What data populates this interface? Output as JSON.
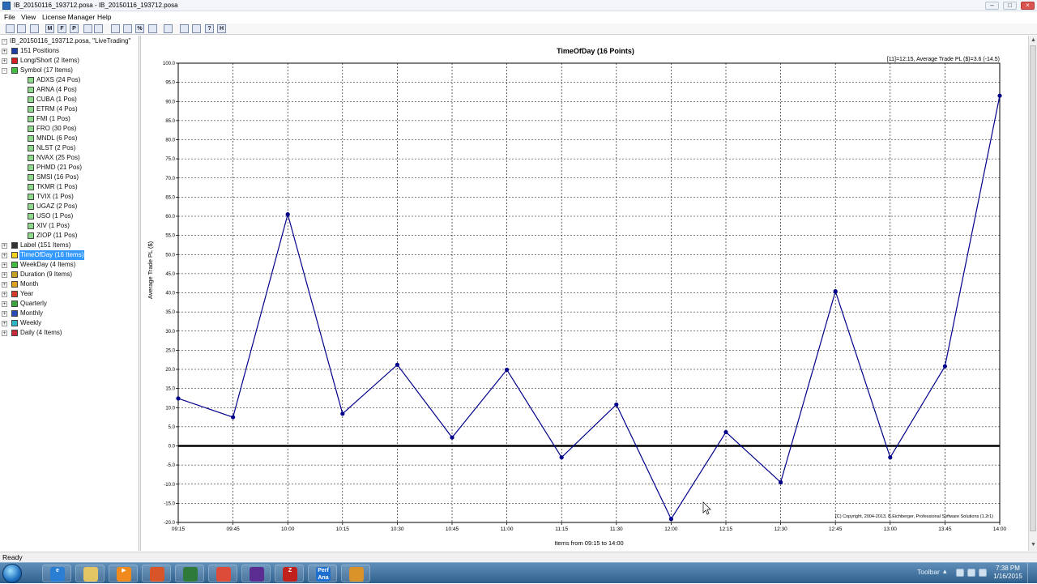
{
  "window": {
    "title": "IB_20150116_193712.posa - IB_20150116_193712.posa"
  },
  "menu": {
    "items": [
      "File",
      "View",
      "License Manager",
      "Help"
    ]
  },
  "toolbar": {
    "buttons": [
      {
        "icon": "new-icon",
        "glyph": ""
      },
      {
        "icon": "open-icon",
        "glyph": ""
      },
      {
        "icon": "print-icon",
        "glyph": ""
      },
      {
        "icon": "module-m-icon",
        "glyph": "M"
      },
      {
        "icon": "module-f-icon",
        "glyph": "F"
      },
      {
        "icon": "module-p-icon",
        "glyph": "P"
      },
      {
        "icon": "filter-icon",
        "glyph": ""
      },
      {
        "icon": "calendar-icon",
        "glyph": ""
      },
      {
        "icon": "chart-up-icon",
        "glyph": ""
      },
      {
        "icon": "chart-line-icon",
        "glyph": ""
      },
      {
        "icon": "percent-icon",
        "glyph": "%"
      },
      {
        "icon": "table-icon",
        "glyph": ""
      },
      {
        "icon": "tools-icon",
        "glyph": ""
      },
      {
        "icon": "report-icon",
        "glyph": ""
      },
      {
        "icon": "layers-icon",
        "glyph": ""
      },
      {
        "icon": "help-icon",
        "glyph": "?"
      },
      {
        "icon": "module-h-icon",
        "glyph": "H"
      }
    ]
  },
  "tree": {
    "root": "IB_20150116_193712.posa, \"LiveTrading\"",
    "items": [
      {
        "label": "151 Positions",
        "level": 1,
        "color": "#1f3fa8",
        "exp": "+"
      },
      {
        "label": "Long/Short (2 Items)",
        "level": 1,
        "color": "#d42020",
        "exp": "+"
      },
      {
        "label": "Symbol (17 Items)",
        "level": 1,
        "color": "#3fbf3f",
        "exp": "-"
      },
      {
        "label": "ADXS (24 Pos)",
        "level": 2,
        "color": "#8fd98f",
        "exp": ""
      },
      {
        "label": "ARNA (4 Pos)",
        "level": 2,
        "color": "#8fd98f",
        "exp": ""
      },
      {
        "label": "CUBA (1 Pos)",
        "level": 2,
        "color": "#8fd98f",
        "exp": ""
      },
      {
        "label": "ETRM (4 Pos)",
        "level": 2,
        "color": "#8fd98f",
        "exp": ""
      },
      {
        "label": "FMI (1 Pos)",
        "level": 2,
        "color": "#8fd98f",
        "exp": ""
      },
      {
        "label": "FRO (30 Pos)",
        "level": 2,
        "color": "#8fd98f",
        "exp": ""
      },
      {
        "label": "MNDL (6 Pos)",
        "level": 2,
        "color": "#8fd98f",
        "exp": ""
      },
      {
        "label": "NLST (2 Pos)",
        "level": 2,
        "color": "#8fd98f",
        "exp": ""
      },
      {
        "label": "NVAX (25 Pos)",
        "level": 2,
        "color": "#8fd98f",
        "exp": ""
      },
      {
        "label": "PHMD (21 Pos)",
        "level": 2,
        "color": "#8fd98f",
        "exp": ""
      },
      {
        "label": "SMSI (16 Pos)",
        "level": 2,
        "color": "#8fd98f",
        "exp": ""
      },
      {
        "label": "TKMR (1 Pos)",
        "level": 2,
        "color": "#8fd98f",
        "exp": ""
      },
      {
        "label": "TVIX (1 Pos)",
        "level": 2,
        "color": "#8fd98f",
        "exp": ""
      },
      {
        "label": "UGAZ (2 Pos)",
        "level": 2,
        "color": "#8fd98f",
        "exp": ""
      },
      {
        "label": "USO (1 Pos)",
        "level": 2,
        "color": "#8fd98f",
        "exp": ""
      },
      {
        "label": "XIV (1 Pos)",
        "level": 2,
        "color": "#8fd98f",
        "exp": ""
      },
      {
        "label": "ZIOP (11 Pos)",
        "level": 2,
        "color": "#8fd98f",
        "exp": ""
      },
      {
        "label": "Label (151 Items)",
        "level": 1,
        "color": "#333333",
        "exp": "+"
      },
      {
        "label": "TimeOfDay (16 Items)",
        "level": 1,
        "color": "#f2d21a",
        "exp": "+",
        "selected": true
      },
      {
        "label": "WeekDay (4 Items)",
        "level": 1,
        "color": "#3fbf3f",
        "exp": "+"
      },
      {
        "label": "Duration (9 Items)",
        "level": 1,
        "color": "#c8a020",
        "exp": "+"
      },
      {
        "label": "Month",
        "level": 1,
        "color": "#e0a020",
        "exp": "+"
      },
      {
        "label": "Year",
        "level": 1,
        "color": "#d83a2a",
        "exp": "+"
      },
      {
        "label": "Quarterly",
        "level": 1,
        "color": "#3aa83a",
        "exp": "+"
      },
      {
        "label": "Monthly",
        "level": 1,
        "color": "#2a4ab8",
        "exp": "+"
      },
      {
        "label": "Weekly",
        "level": 1,
        "color": "#2ab8c8",
        "exp": "+"
      },
      {
        "label": "Daily (4 Items)",
        "level": 1,
        "color": "#c82a3a",
        "exp": "+"
      }
    ]
  },
  "chart_data": {
    "type": "line",
    "title": "TimeOfDay (16 Points)",
    "info": "[11]=12:15,   Average Trade PL ($)=3.6 (-14.5)",
    "ylabel": "Average Trade PL ($)",
    "xlabel": "Items from 09:15 to 14:00",
    "copyright": "(C) Copyright, 2004-2013, B.Eichberger, Professional Software Solutions (1.2r1)",
    "ylim": [
      -20,
      100
    ],
    "ystep": 5,
    "ytick_labels": [
      "-20.0",
      "-15.0",
      "-10.0",
      "-5.0",
      "0.0",
      "5.0",
      "10.0",
      "15.0",
      "20.0",
      "25.0",
      "30.0",
      "35.0",
      "40.0",
      "45.0",
      "50.0",
      "55.0",
      "60.0",
      "65.0",
      "70.0",
      "75.0",
      "80.0",
      "85.0",
      "90.0",
      "95.0",
      "100.0"
    ],
    "categories": [
      "09:15",
      "09:45",
      "10:00",
      "10:15",
      "10:30",
      "10:45",
      "11:00",
      "11:15",
      "11:30",
      "12:00",
      "12:15",
      "12:30",
      "12:45",
      "13:00",
      "13:45",
      "14:00"
    ],
    "values": [
      12.4,
      7.5,
      60.5,
      8.4,
      21.2,
      2.2,
      19.9,
      -3.0,
      10.8,
      -19.1,
      3.6,
      -9.5,
      40.4,
      -3.0,
      20.8,
      91.5
    ],
    "line_color": "#00008b",
    "zero_line": true,
    "grid": true
  },
  "status": {
    "text": "Ready"
  },
  "taskbar": {
    "apps": [
      {
        "icon": "internet-explorer-icon",
        "color": "#2a7fd4",
        "glyph": "e"
      },
      {
        "icon": "file-explorer-icon",
        "color": "#e3c565",
        "glyph": ""
      },
      {
        "icon": "media-player-icon",
        "color": "#f08a1c",
        "glyph": "▶"
      },
      {
        "icon": "paint-icon",
        "color": "#d8552a",
        "glyph": ""
      },
      {
        "icon": "terminal-icon",
        "color": "#2d7a3a",
        "glyph": ""
      },
      {
        "icon": "chrome-icon",
        "color": "#dd4b39",
        "glyph": ""
      },
      {
        "icon": "visual-studio-icon",
        "color": "#5b2d91",
        "glyph": ""
      },
      {
        "icon": "filezilla-icon",
        "color": "#c0211d",
        "glyph": "Z"
      },
      {
        "icon": "perf-ana-icon",
        "color": "#1f6fd1",
        "glyph": "Perf Ana"
      },
      {
        "icon": "network-icon",
        "color": "#d9922a",
        "glyph": ""
      }
    ],
    "toolbar_label": "Toolbar",
    "time": "7:38 PM",
    "date": "1/16/2015"
  }
}
